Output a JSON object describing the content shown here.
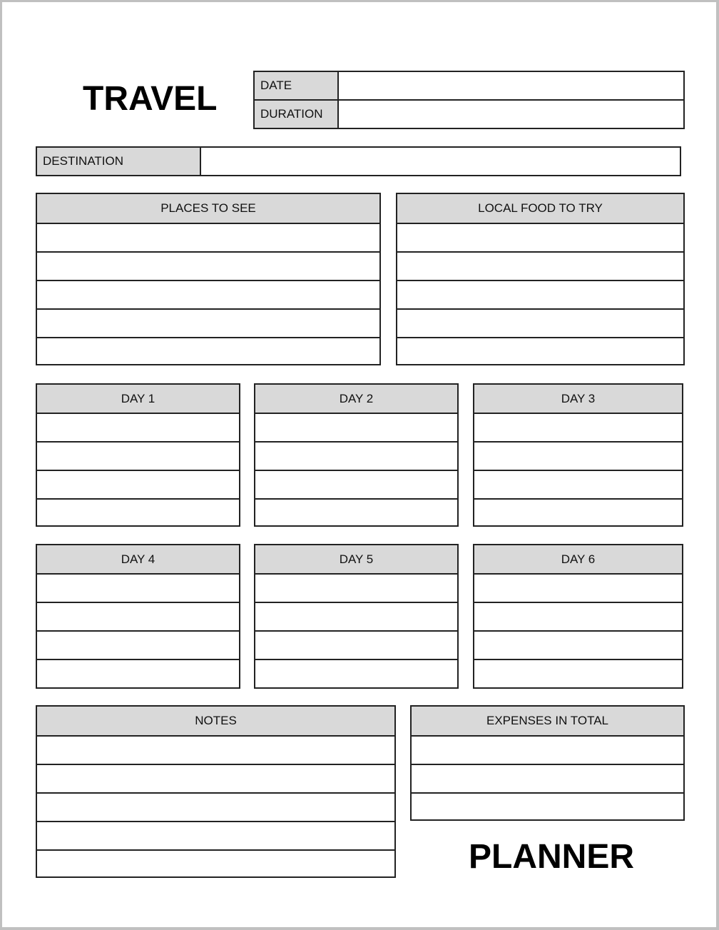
{
  "header": {
    "title_top": "TRAVEL",
    "title_bottom": "PLANNER"
  },
  "fields": {
    "date_label": "DATE",
    "date_value": "",
    "duration_label": "DURATION",
    "duration_value": "",
    "destination_label": "DESTINATION",
    "destination_value": ""
  },
  "sections": {
    "places": {
      "label": "PLACES TO SEE",
      "rows": [
        "",
        "",
        "",
        "",
        ""
      ]
    },
    "food": {
      "label": "LOCAL FOOD TO TRY",
      "rows": [
        "",
        "",
        "",
        "",
        ""
      ]
    },
    "days": [
      {
        "label": "DAY 1",
        "rows": [
          "",
          "",
          "",
          ""
        ]
      },
      {
        "label": "DAY 2",
        "rows": [
          "",
          "",
          "",
          ""
        ]
      },
      {
        "label": "DAY 3",
        "rows": [
          "",
          "",
          "",
          ""
        ]
      },
      {
        "label": "DAY 4",
        "rows": [
          "",
          "",
          "",
          ""
        ]
      },
      {
        "label": "DAY 5",
        "rows": [
          "",
          "",
          "",
          ""
        ]
      },
      {
        "label": "DAY 6",
        "rows": [
          "",
          "",
          "",
          ""
        ]
      }
    ],
    "notes": {
      "label": "NOTES",
      "rows": [
        "",
        "",
        "",
        "",
        ""
      ]
    },
    "expenses": {
      "label": "EXPENSES IN TOTAL",
      "rows": [
        "",
        "",
        ""
      ]
    }
  },
  "colors": {
    "header_fill": "#d9d9d9",
    "border": "#222222",
    "frame": "#c0c0c0"
  }
}
